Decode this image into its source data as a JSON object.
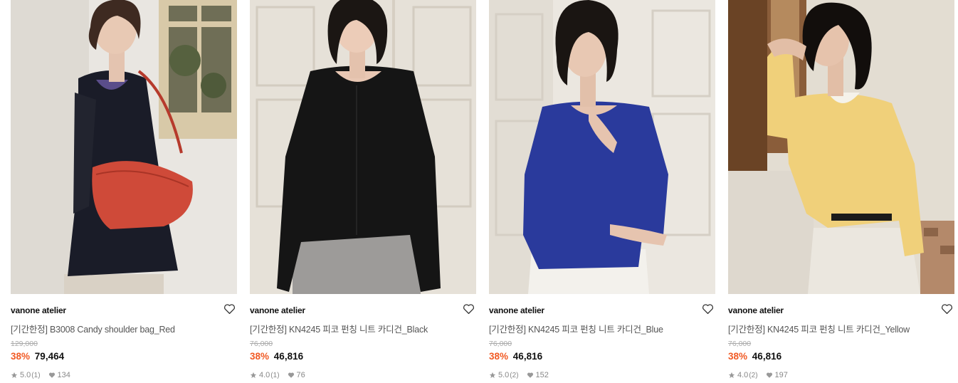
{
  "products": [
    {
      "brand": "vanone atelier",
      "name": "[기간한정] B3008 Candy shoulder bag_Red",
      "original_price": "129,000",
      "discount": "38%",
      "price": "79,464",
      "rating": "5.0",
      "review_count": "(1)",
      "likes": "134",
      "image_theme": "black tweed jacket with red shoulder bag"
    },
    {
      "brand": "vanone atelier",
      "name": "[기간한정] KN4245 피코 펀칭 니트 카디건_Black",
      "original_price": "76,000",
      "discount": "38%",
      "price": "46,816",
      "rating": "4.0",
      "review_count": "(1)",
      "likes": "76",
      "image_theme": "black knit cardigan"
    },
    {
      "brand": "vanone atelier",
      "name": "[기간한정] KN4245 피코 펀칭 니트 카디건_Blue",
      "original_price": "76,000",
      "discount": "38%",
      "price": "46,816",
      "rating": "5.0",
      "review_count": "(2)",
      "likes": "152",
      "image_theme": "blue knit cardigan"
    },
    {
      "brand": "vanone atelier",
      "name": "[기간한정] KN4245 피코 펀칭 니트 카디건_Yellow",
      "original_price": "76,000",
      "discount": "38%",
      "price": "46,816",
      "rating": "4.0",
      "review_count": "(2)",
      "likes": "197",
      "image_theme": "yellow knit cardigan"
    }
  ],
  "colors": {
    "discount": "#f15a24",
    "price": "#111111",
    "muted": "#888888"
  },
  "icons": {
    "wishlist": "heart-outline-icon",
    "rating": "star-icon",
    "likes": "heart-filled-icon"
  }
}
